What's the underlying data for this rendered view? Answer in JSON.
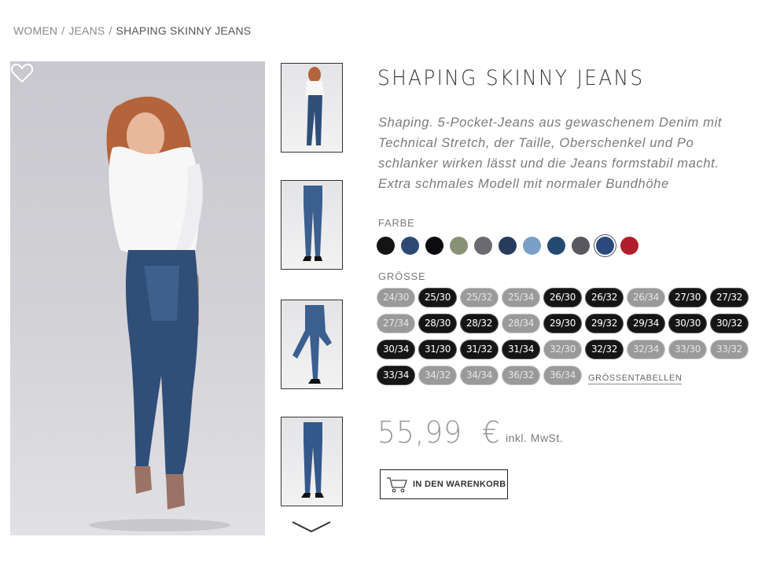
{
  "breadcrumb": {
    "items": [
      "WOMEN",
      "JEANS"
    ],
    "current": "SHAPING SKINNY JEANS",
    "separator": "/"
  },
  "product": {
    "title": "SHAPING SKINNY JEANS",
    "description": "Shaping. 5-Pocket-Jeans aus gewaschenem Denim mit Technical Stretch, der Taille, Oberschenkel und Po schlanker wirken lässt und die Jeans formstabil macht. Extra schmales Modell mit normaler Bundhöhe",
    "images": {
      "main": "model-front-full",
      "thumbnails": [
        "model-front-full",
        "jeans-front",
        "jeans-side",
        "jeans-front-alt"
      ]
    }
  },
  "colors": {
    "label": "FARBE",
    "options": [
      "#141414",
      "#2c4a74",
      "#0c0c10",
      "#8a9276",
      "#6a6a70",
      "#273b5c",
      "#7aa0c8",
      "#244a72",
      "#58585e",
      "#2a4a7e",
      "#b01e2c"
    ],
    "selected_index": 9
  },
  "sizes": {
    "label": "GRÖSSE",
    "options": [
      {
        "label": "24/30",
        "available": false
      },
      {
        "label": "25/30",
        "available": true
      },
      {
        "label": "25/32",
        "available": false
      },
      {
        "label": "25/34",
        "available": false
      },
      {
        "label": "26/30",
        "available": true
      },
      {
        "label": "26/32",
        "available": true
      },
      {
        "label": "26/34",
        "available": false
      },
      {
        "label": "27/30",
        "available": true
      },
      {
        "label": "27/32",
        "available": true
      },
      {
        "label": "27/34",
        "available": false
      },
      {
        "label": "28/30",
        "available": true
      },
      {
        "label": "28/32",
        "available": true
      },
      {
        "label": "28/34",
        "available": false
      },
      {
        "label": "29/30",
        "available": true
      },
      {
        "label": "29/32",
        "available": true
      },
      {
        "label": "29/34",
        "available": true
      },
      {
        "label": "30/30",
        "available": true
      },
      {
        "label": "30/32",
        "available": true
      },
      {
        "label": "30/34",
        "available": true
      },
      {
        "label": "31/30",
        "available": true
      },
      {
        "label": "31/32",
        "available": true
      },
      {
        "label": "31/34",
        "available": true
      },
      {
        "label": "32/30",
        "available": false
      },
      {
        "label": "32/32",
        "available": true
      },
      {
        "label": "32/34",
        "available": false
      },
      {
        "label": "33/30",
        "available": false
      },
      {
        "label": "33/32",
        "available": false
      },
      {
        "label": "33/34",
        "available": true
      },
      {
        "label": "34/32",
        "available": false
      },
      {
        "label": "34/34",
        "available": false
      },
      {
        "label": "36/32",
        "available": false
      },
      {
        "label": "36/34",
        "available": false
      }
    ],
    "size_table_link": "GRÖSSENTABELLEN"
  },
  "price": {
    "amount": "55,99",
    "currency": "€",
    "tax_note": "inkl. MwSt."
  },
  "cart": {
    "label": "IN DEN WARENKORB",
    "icon": "cart-icon"
  },
  "icons": {
    "wishlist": "heart-icon",
    "more_thumbnails": "chevron-down-icon"
  }
}
